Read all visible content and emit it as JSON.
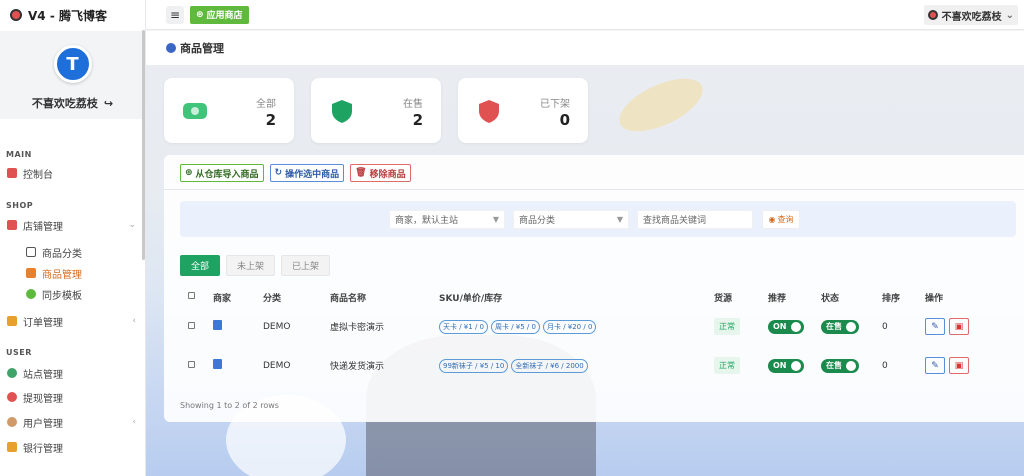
{
  "app": {
    "title": "V4 - 腾飞博客"
  },
  "profile": {
    "name": "不喜欢吃荔枝",
    "avatar_letter": "T"
  },
  "sidebar": {
    "sections": [
      {
        "title": "MAIN"
      },
      {
        "title": "SHOP"
      },
      {
        "title": "USER"
      }
    ],
    "items": [
      {
        "label": "控制台",
        "icon": "dashboard-icon",
        "color": "#e05252"
      },
      {
        "label": "店铺管理",
        "icon": "store-icon",
        "color": "#e05252"
      },
      {
        "label": "商品分类",
        "icon": "grid-icon",
        "color": "#555555"
      },
      {
        "label": "商品管理",
        "icon": "box-icon",
        "color": "#e8802c"
      },
      {
        "label": "同步模板",
        "icon": "sync-icon",
        "color": "#5fb93c"
      },
      {
        "label": "订单管理",
        "icon": "order-icon",
        "color": "#e8a02c"
      },
      {
        "label": "站点管理",
        "icon": "site-icon",
        "color": "#3fa36a"
      },
      {
        "label": "提现管理",
        "icon": "withdraw-icon",
        "color": "#e05252"
      },
      {
        "label": "用户管理",
        "icon": "user-icon",
        "color": "#d09a6a"
      },
      {
        "label": "银行管理",
        "icon": "bank-icon",
        "color": "#e8a02c"
      }
    ]
  },
  "topbar": {
    "menu_glyph": "≡",
    "store_label": "应用商店",
    "user_name": "不喜欢吃荔枝"
  },
  "page": {
    "title": "商品管理"
  },
  "stats": [
    {
      "label": "全部",
      "value": "2",
      "color": "#3fc47a"
    },
    {
      "label": "在售",
      "value": "2",
      "color": "#1ea362"
    },
    {
      "label": "已下架",
      "value": "0",
      "color": "#e05252"
    }
  ],
  "actions": {
    "import": "从仓库导入商品",
    "operate": "操作选中商品",
    "remove": "移除商品"
  },
  "search": {
    "merchant_placeholder": "商家，默认主站",
    "category_placeholder": "商品分类",
    "keyword_placeholder": "查找商品关键词",
    "query_label": "查询"
  },
  "tabs": [
    "全部",
    "未上架",
    "已上架"
  ],
  "table": {
    "headers": [
      "商家",
      "分类",
      "商品名称",
      "SKU/单价/库存",
      "货源",
      "推荐",
      "状态",
      "排序",
      "操作"
    ],
    "rows": [
      {
        "category": "DEMO",
        "name": "虚拟卡密演示",
        "skus": [
          "天卡 / ¥1 / 0",
          "周卡 / ¥5 / 0",
          "月卡 / ¥20 / 0"
        ],
        "source": "正常",
        "recommend": "ON",
        "status": "在售",
        "sort": "0"
      },
      {
        "category": "DEMO",
        "name": "快递发货演示",
        "skus": [
          "99新袜子 / ¥5 / 10",
          "全新袜子 / ¥6 / 2000"
        ],
        "source": "正常",
        "recommend": "ON",
        "status": "在售",
        "sort": "0"
      }
    ]
  },
  "footer": {
    "text": "Showing 1 to 2 of 2 rows"
  }
}
